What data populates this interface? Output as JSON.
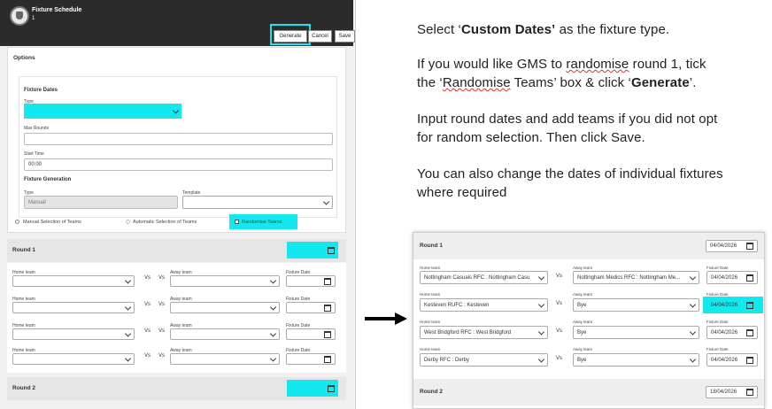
{
  "app": {
    "title": "Fixture Schedule",
    "subtitle": "1"
  },
  "toolbar": {
    "generate_label": "Generate",
    "cancel_label": "Cancel",
    "save_label": "Save"
  },
  "options": {
    "heading": "Options",
    "fixture_dates_heading": "Fixture Dates",
    "type_label": "Type",
    "type_value": "",
    "max_rounds_label": "Max Rounds",
    "max_rounds_value": "",
    "start_time_label": "Start Time",
    "start_time_value": "00:00",
    "fixture_generation_heading": "Fixture Generation",
    "gen_type_label": "Type",
    "gen_type_value": "Manual",
    "template_label": "Template",
    "template_value": "",
    "radio_manual": "Manual Selection of Teams",
    "radio_automatic": "Automatic Selection of Teams",
    "randomise_label": "Randomise Teams"
  },
  "left_rounds": [
    {
      "title": "Round 1"
    },
    {
      "title": "Round 2"
    }
  ],
  "field_labels": {
    "home_team": "Home team",
    "away_team": "Away team",
    "fixture_date": "Fixture Date",
    "vs": "Vs"
  },
  "instructions": {
    "p1_pre": "Select ‘",
    "p1_bold": "Custom Dates’",
    "p1_post": " as the fixture type.",
    "p2_a": "If you would like GMS to ",
    "p2_b": "randomise",
    "p2_c": " round 1, tick",
    "p2_d": "the ‘",
    "p2_e": "Randomise",
    "p2_f": " Teams’ box & click ‘",
    "p2_g": "Generate",
    "p2_h": "’.",
    "p3_l1": "Input round dates and add teams if you did not opt",
    "p3_l2": "for random selection. Then click Save.",
    "p4_l1": "You can also change the dates of individual fixtures",
    "p4_l2": "where required"
  },
  "right_panel": {
    "round1_title": "Round 1",
    "round1_date": "04/04/2026",
    "round2_title": "Round 2",
    "round2_date": "18/04/2026",
    "fixtures": [
      {
        "home": "Nottingham Casuals RFC : Nottingham Casu",
        "away": "Nottingham Medics RFC : Nottingham Me...",
        "date": "04/04/2026"
      },
      {
        "home": "Kesteven RUFC : Kesteven",
        "away": "Bye",
        "date": "04/04/2026"
      },
      {
        "home": "West Bridgford RFC : West Bridgford",
        "away": "Bye",
        "date": "04/04/2026"
      },
      {
        "home": "Derby RFC : Derby",
        "away": "Bye",
        "date": "04/04/2026"
      }
    ]
  },
  "colors": {
    "highlight": "#13e8ee",
    "titlebar": "#2b2b2b"
  }
}
